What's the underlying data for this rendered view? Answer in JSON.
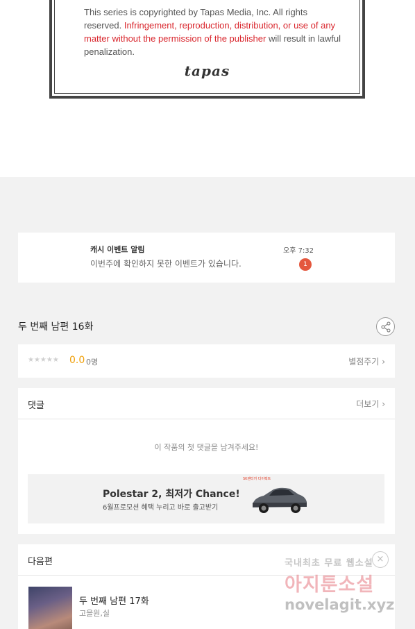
{
  "copyright": {
    "text_plain_1": "This series is copyrighted by Tapas Media, Inc. All rights reserved.",
    "text_warning": "Infringement, reproduction, distribution, or use of any matter without the permission of the publisher",
    "text_plain_2": "will result in lawful penalization.",
    "logo": "tapas"
  },
  "notification": {
    "title": "캐시 이벤트 알림",
    "message": "이번주에 확인하지 못한 이벤트가 있습니다.",
    "time": "오후 7:32",
    "badge_count": "1"
  },
  "episode": {
    "title": "두 번째 남편 16화",
    "share_icon": "share-icon"
  },
  "rating": {
    "stars": "★★★★★",
    "score": "0.0",
    "count": "0명",
    "rate_link": "별점주기",
    "chevron": "›"
  },
  "comments": {
    "title": "댓글",
    "more_link": "더보기",
    "chevron": "›",
    "empty_message": "이 작품의 첫 댓글을 남겨주세요!"
  },
  "ad": {
    "brand": "SK렌터카 다이렉트",
    "title": "Polestar 2, 최저가 Chance!",
    "subtitle": "6월프로모션 혜택 누리고 바로 출고받기"
  },
  "next_episode": {
    "section_title": "다음편",
    "close_icon": "×",
    "title": "두 번째 남편 17화",
    "author": "고을원,실"
  },
  "watermark": {
    "line1": "국내최초 무료 웹소설",
    "line2": "아지툰소설",
    "line3": "novelagit.xyz"
  },
  "colors": {
    "accent_score": "#f0a00a",
    "badge": "#e4573d",
    "warning_text": "#d9262d"
  }
}
